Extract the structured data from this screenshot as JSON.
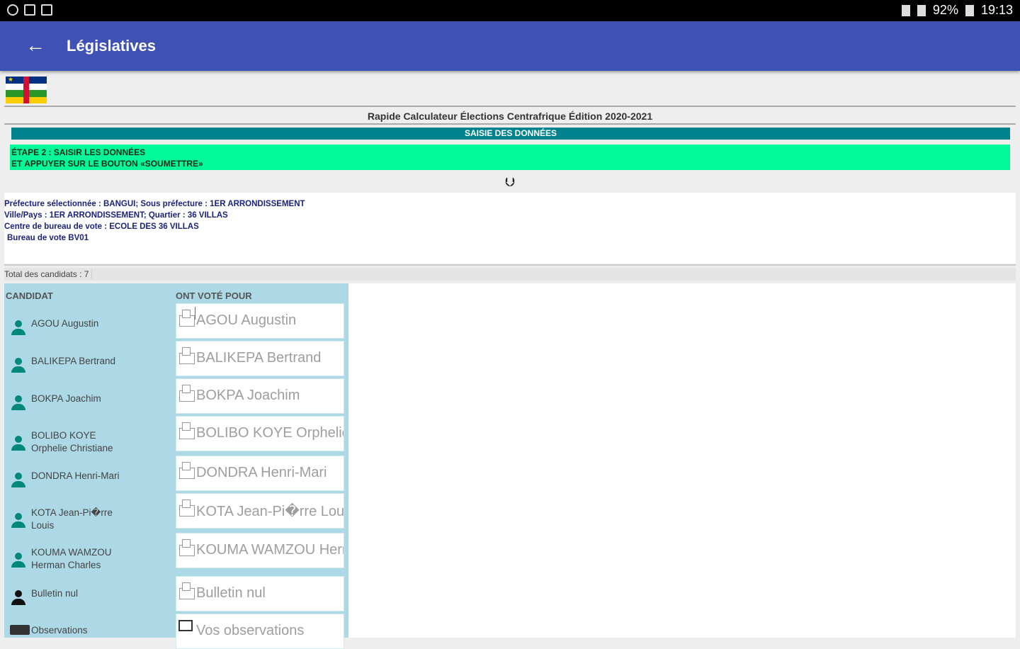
{
  "status_bar": {
    "battery": "92%",
    "time": "19:13"
  },
  "appbar": {
    "title": "Législatives",
    "back_icon": "arrow-left-icon"
  },
  "header": {
    "subtitle": "Rapide Calculateur Élections Centrafrique Édition 2020-2021",
    "section_title": "SAISIE DES DONNÉES",
    "step_line1": "ÉTAPE 2 : SAISIR LES DONNÉES",
    "step_line2": "ET APPUYER SUR LE BOUTON «SOUMETTRE»"
  },
  "info": {
    "line1": "Préfecture sélectionnée : BANGUI; Sous préfecture : 1ER ARRONDISSEMENT",
    "line2": "Ville/Pays : 1ER ARRONDISSEMENT; Quartier : 36 VILLAS",
    "line3": "Centre de bureau de vote : ECOLE DES 36 VILLAS",
    "line4": "Bureau de vote BV01"
  },
  "total": "Total des candidats : 7",
  "table": {
    "col_candidat": "CANDIDAT",
    "col_votes": "ONT VOTÉ POUR",
    "candidates": [
      {
        "name": "AGOU Augustin",
        "placeholder": "AGOU Augustin"
      },
      {
        "name": "BALIKEPA Bertrand",
        "placeholder": "BALIKEPA Bertrand"
      },
      {
        "name": "BOKPA Joachim",
        "placeholder": "BOKPA Joachim"
      },
      {
        "name_line1": "BOLIBO KOYE",
        "name_line2": "Orphelie Christiane",
        "placeholder": "BOLIBO KOYE Orphelie C"
      },
      {
        "name": "DONDRA Henri-Mari",
        "placeholder": "DONDRA Henri-Mari"
      },
      {
        "name_line1": "KOTA Jean-Pi�rre",
        "name_line2": "Louis",
        "placeholder": "KOTA Jean-Pi�rre Loui"
      },
      {
        "name_line1": "KOUMA WAMZOU",
        "name_line2": "Herman Charles",
        "placeholder": "KOUMA WAMZOU Herm"
      }
    ],
    "null_label": "Bulletin nul",
    "null_placeholder": "Bulletin nul",
    "obs_label": "Observations",
    "obs_placeholder": "Vos observations"
  },
  "colors": {
    "appbar": "#3f51b5",
    "teal": "#00838f",
    "green": "#00fa9a",
    "candidate_panel": "#add8e6",
    "person_icon": "#00897b"
  }
}
